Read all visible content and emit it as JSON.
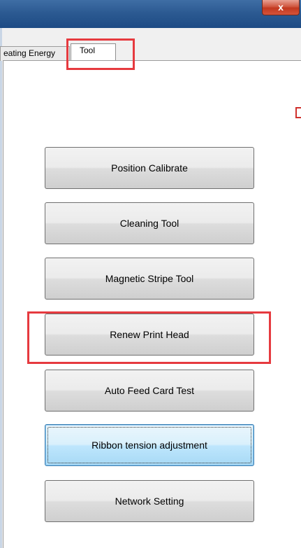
{
  "window": {
    "close_glyph": "x"
  },
  "tabs": [
    {
      "label": "eating Energy",
      "selected": false
    },
    {
      "label": "Tool",
      "selected": true
    }
  ],
  "buttons": [
    {
      "label": "Position Calibrate"
    },
    {
      "label": "Cleaning Tool"
    },
    {
      "label": "Magnetic Stripe Tool"
    },
    {
      "label": "Renew Print Head"
    },
    {
      "label": "Auto Feed Card Test"
    },
    {
      "label": "Ribbon tension adjustment",
      "focused": true
    },
    {
      "label": "Network Setting"
    }
  ],
  "colors": {
    "highlight": "#e63a3f",
    "titlebar": "#2c5a92",
    "focus_button": "#bee6fd"
  },
  "icons": {
    "close": "close-icon"
  }
}
